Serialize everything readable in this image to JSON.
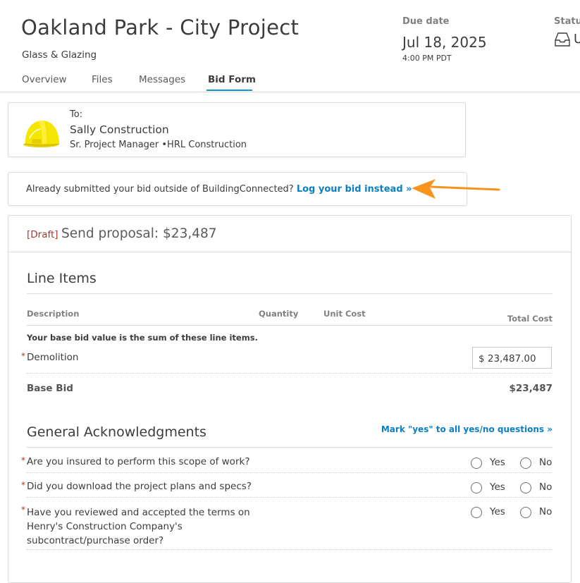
{
  "header": {
    "title": "Oakland Park - City Project",
    "subtitle": "Glass & Glazing",
    "due_label": "Due date",
    "due_date": "Jul 18, 2025",
    "due_time": "4:00 PM PDT",
    "status_label": "Status",
    "status_value": "U",
    "status_icon": "inbox-icon"
  },
  "tabs": [
    {
      "label": "Overview"
    },
    {
      "label": "Files"
    },
    {
      "label": "Messages"
    },
    {
      "label": "Bid Form",
      "active": true
    }
  ],
  "recipient": {
    "to_label": "To:",
    "name": "Sally Construction",
    "role": "Sr. Project Manager •HRL Construction",
    "avatar_icon": "hard-hat-icon"
  },
  "notice": {
    "text": "Already submitted your bid outside of BuildingConnected? ",
    "link": "Log your bid instead »"
  },
  "proposal": {
    "draft_tag": "[Draft]",
    "title": "Send proposal: $23,487",
    "line_items": {
      "title": "Line Items",
      "columns": [
        "Description",
        "Quantity",
        "Unit Cost",
        "Total Cost"
      ],
      "note": "Your base bid value is the sum of these line items.",
      "rows": [
        {
          "label": "Demolition",
          "value": "$ 23,487.00",
          "required": "*"
        }
      ],
      "base_label": "Base Bid",
      "base_value": "$23,487"
    },
    "acknowledgments": {
      "title": "General Acknowledgments",
      "mark_all": "Mark \"yes\" to all yes/no questions »",
      "yes_label": "Yes",
      "no_label": "No",
      "questions": [
        {
          "text": "Are you insured to perform this scope of work?",
          "required": "*"
        },
        {
          "text": "Did you download the project plans and specs?",
          "required": "*"
        },
        {
          "text": "Have you reviewed and accepted the terms on Henry's Construction Company's subcontract/purchase order?",
          "required": "*"
        }
      ]
    }
  },
  "colors": {
    "accent": "#0a96d2",
    "link": "#0a7fc2",
    "draft": "#b0342b",
    "arrow": "#f7941d"
  }
}
